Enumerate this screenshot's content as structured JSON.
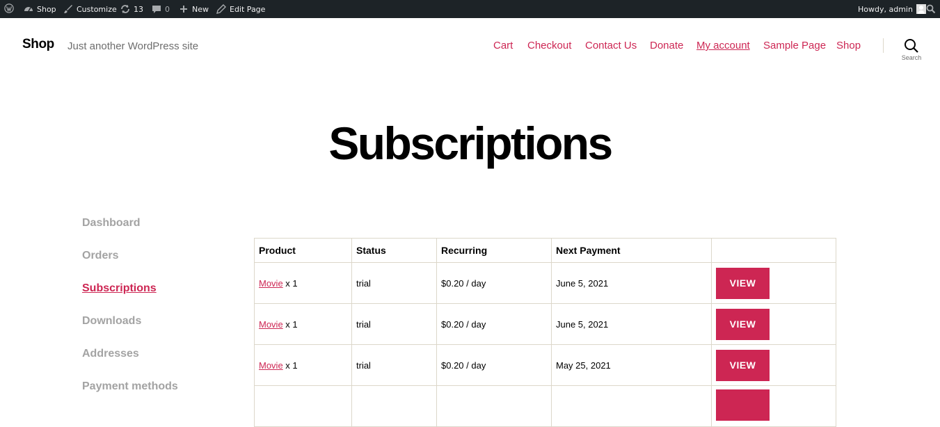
{
  "adminbar": {
    "site_name": "Shop",
    "customize": "Customize",
    "updates_count": "13",
    "comments_count": "0",
    "new_label": "New",
    "edit_page": "Edit Page",
    "howdy": "Howdy, admin"
  },
  "header": {
    "site_title": "Shop",
    "tagline": "Just another WordPress site",
    "nav": [
      "Cart",
      "Checkout",
      "Contact Us",
      "Donate",
      "My account",
      "Sample Page",
      "Shop"
    ],
    "current_nav": "My account",
    "search_label": "Search"
  },
  "page": {
    "title": "Subscriptions"
  },
  "account_nav": {
    "items": [
      "Dashboard",
      "Orders",
      "Subscriptions",
      "Downloads",
      "Addresses",
      "Payment methods"
    ],
    "active": "Subscriptions"
  },
  "table": {
    "headers": [
      "Product",
      "Status",
      "Recurring",
      "Next Payment",
      ""
    ],
    "rows": [
      {
        "product": "Movie",
        "qty": " x 1",
        "status": "trial",
        "recurring": "$0.20 / day",
        "next_payment": "June 5, 2021",
        "action": "VIEW"
      },
      {
        "product": "Movie",
        "qty": " x 1",
        "status": "trial",
        "recurring": "$0.20 / day",
        "next_payment": "June 5, 2021",
        "action": "VIEW"
      },
      {
        "product": "Movie",
        "qty": " x 1",
        "status": "trial",
        "recurring": "$0.20 / day",
        "next_payment": "May 25, 2021",
        "action": "VIEW"
      },
      {
        "product": "",
        "qty": "",
        "status": "",
        "recurring": "",
        "next_payment": "",
        "action": ""
      }
    ]
  },
  "colors": {
    "accent": "#cd2653",
    "adminbar_bg": "#1d2327",
    "muted_nav": "#a3a3a3"
  }
}
